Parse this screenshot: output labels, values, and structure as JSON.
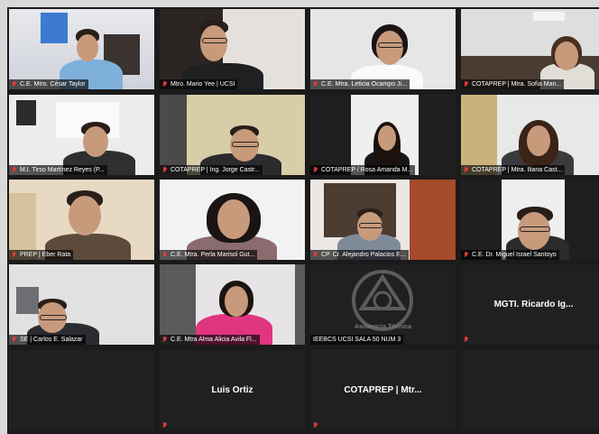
{
  "participants": [
    {
      "label": "C.E. Mtro. César Taylor"
    },
    {
      "label": "Mtro. Mario Yee | UCSI"
    },
    {
      "label": "C.E. Mtra. Leticia Ocampo Ji..."
    },
    {
      "label": "COTAPREP | Mtra. Sofía Man..."
    },
    {
      "label": "M.I. Tirso Martínez Reyes (P..."
    },
    {
      "label": "COTAPREP | Ing. Jorge Castr..."
    },
    {
      "label": "COTAPREP / Rosa Amanda M..."
    },
    {
      "label": "COTAPREP | Mtra. Iliana Cast..."
    },
    {
      "label": "PREP | Eber Rata"
    },
    {
      "label": "C.E. Mtra. Perla Marisol Gut..."
    },
    {
      "label": "CP. Cr. Alejandro Palacios E..."
    },
    {
      "label": "C.E. Dr. Miguel Israel Santoyo"
    },
    {
      "label": "SE | Carlos E. Salazar"
    },
    {
      "label": "C.E. Mtra Alma Alicia Avila Fl..."
    },
    {
      "label": "IEEBCS UCSI SALA 50 NUM 3"
    },
    {
      "display_name": "MGTI. Ricardo Ig..."
    },
    {
      "display_name": "Luis Ortiz"
    },
    {
      "display_name": "COTAPREP | Mtr..."
    }
  ],
  "logo_text": "Asistencia Técnica",
  "colors": {
    "active_speaker": "#f2e04a",
    "muted_mic": "#e03a3a"
  }
}
